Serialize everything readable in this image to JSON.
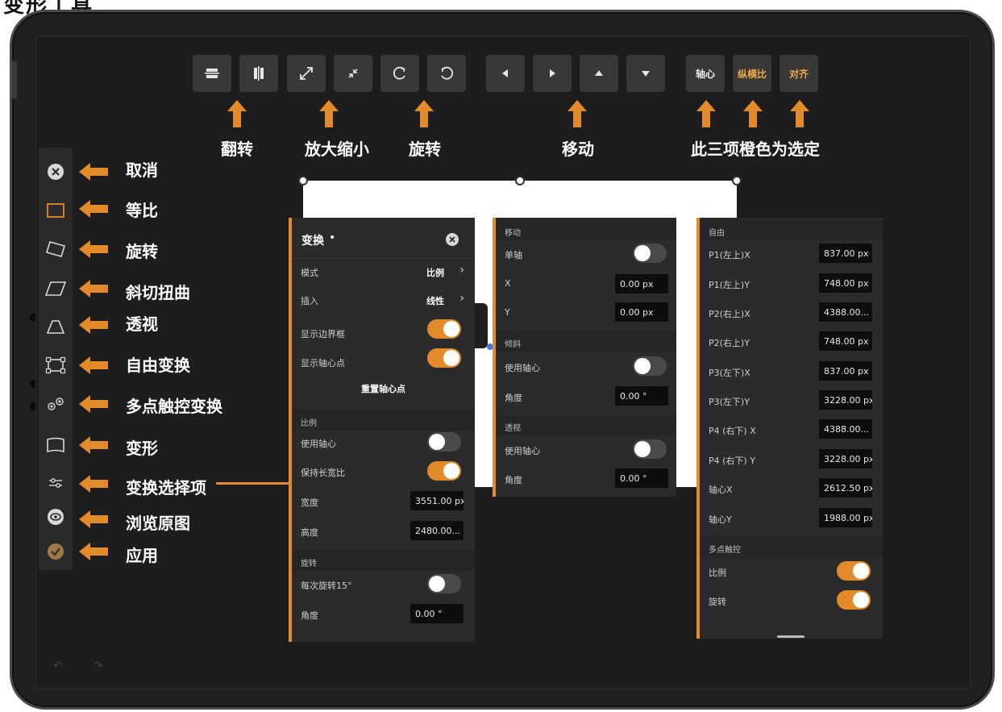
{
  "page_title": "变形工具",
  "colors": {
    "accent": "#e38a2a",
    "toolbar_bg": "#383838",
    "panel_bg": "#2b2b2b"
  },
  "toolbar": {
    "buttons": [
      {
        "name": "flip-vertical-icon"
      },
      {
        "name": "flip-horizontal-icon"
      },
      {
        "name": "scale-up-icon"
      },
      {
        "name": "scale-down-icon"
      },
      {
        "name": "rotate-cw-icon"
      },
      {
        "name": "rotate-ccw-icon"
      },
      {
        "name": "move-left-icon"
      },
      {
        "name": "move-right-icon"
      },
      {
        "name": "move-up-icon"
      },
      {
        "name": "move-down-icon"
      }
    ],
    "pivot_label": "轴心",
    "aspect_label": "纵横比",
    "align_label": "对齐"
  },
  "annotations": {
    "flip": "翻转",
    "scale": "放大缩小",
    "rotate": "旋转",
    "move": "移动",
    "orange_selected": "此三项橙色为选定",
    "tools": [
      "取消",
      "等比",
      "旋转",
      "斜切扭曲",
      "透视",
      "自由变换",
      "多点触控变换",
      "变形",
      "变换选择项",
      "浏览原图",
      "应用"
    ]
  },
  "panel_left": {
    "title": "变换",
    "mode_label": "模式",
    "mode_value": "比例",
    "interp_label": "插入",
    "interp_value": "线性",
    "show_bbox": "显示边界框",
    "show_pivot": "显示轴心点",
    "reset_pivot": "重置轴心点",
    "scale_section": "比例",
    "use_pivot": "使用轴心",
    "keep_ratio": "保持长宽比",
    "width_label": "宽度",
    "width_value": "3551.00 px",
    "height_label": "高度",
    "height_value": "2480.00...",
    "rotate_section": "旋转",
    "rotate_step": "每次旋转15°",
    "angle_label": "角度",
    "angle_value": "0.00 °"
  },
  "panel_mid": {
    "move_section": "移动",
    "single_axis": "单轴",
    "x_label": "X",
    "x_value": "0.00 px",
    "y_label": "Y",
    "y_value": "0.00 px",
    "skew_section": "倾斜",
    "skew_use_pivot": "使用轴心",
    "skew_angle_label": "角度",
    "skew_angle_value": "0.00 °",
    "persp_section": "透视",
    "persp_use_pivot": "使用轴心",
    "persp_angle_label": "角度",
    "persp_angle_value": "0.00 °"
  },
  "panel_right": {
    "free_section": "自由",
    "rows": [
      {
        "label": "P1(左上)X",
        "value": "837.00 px"
      },
      {
        "label": "P1(左上)Y",
        "value": "748.00 px"
      },
      {
        "label": "P2(右上)X",
        "value": "4388.00..."
      },
      {
        "label": "P2(右上)Y",
        "value": "748.00 px"
      },
      {
        "label": "P3(左下)X",
        "value": "837.00 px"
      },
      {
        "label": "P3(左下)Y",
        "value": "3228.00 px"
      },
      {
        "label": "P4 (右下) X",
        "value": "4388.00..."
      },
      {
        "label": "P4 (右下) Y",
        "value": "3228.00 px"
      },
      {
        "label": "轴心X",
        "value": "2612.50 px"
      },
      {
        "label": "轴心Y",
        "value": "1988.00 px"
      }
    ],
    "multitouch_section": "多点触控",
    "mt_scale": "比例",
    "mt_rotate": "旋转"
  }
}
